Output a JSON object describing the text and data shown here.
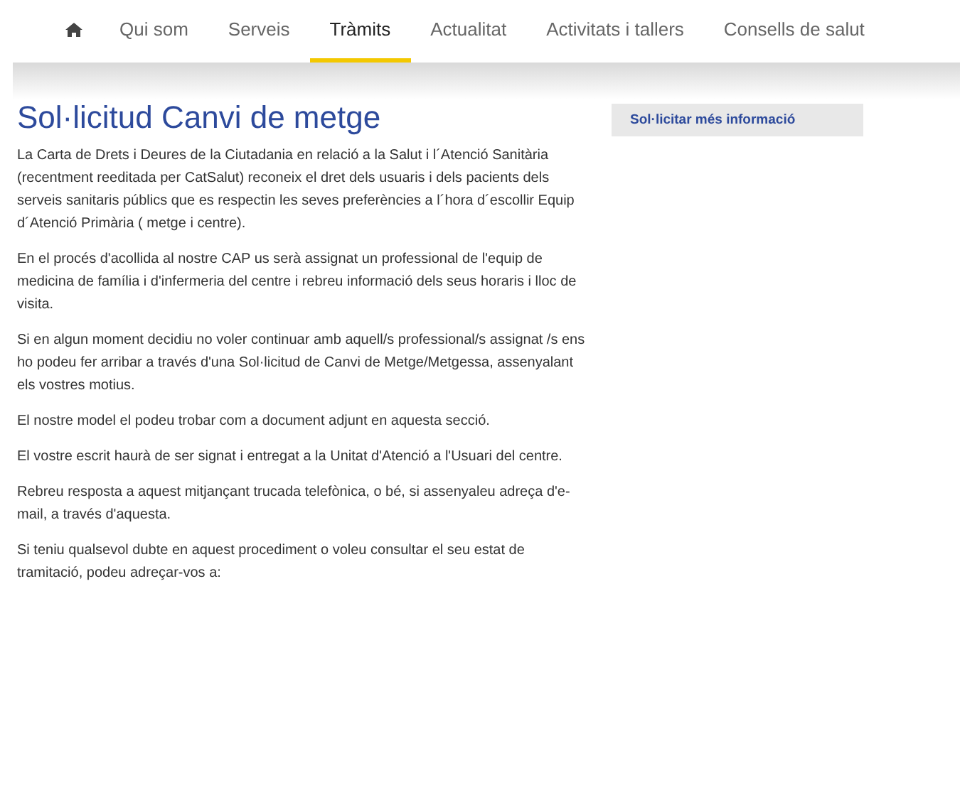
{
  "nav": {
    "items": [
      {
        "kind": "home",
        "selected": false
      },
      {
        "kind": "text",
        "label": "Qui som",
        "selected": false
      },
      {
        "kind": "text",
        "label": "Serveis",
        "selected": false
      },
      {
        "kind": "text",
        "label": "Tràmits",
        "selected": true
      },
      {
        "kind": "text",
        "label": "Actualitat",
        "selected": false
      },
      {
        "kind": "text",
        "label": "Activitats i tallers",
        "selected": false
      },
      {
        "kind": "text",
        "label": "Consells de salut",
        "selected": false
      }
    ]
  },
  "article": {
    "title": "Sol·licitud Canvi de metge",
    "paragraphs": [
      "La Carta de Drets i Deures de la Ciutadania en relació a la Salut i l´Atenció Sanitària (recentment reeditada per CatSalut) reconeix el dret dels usuaris i dels pacients dels serveis sanitaris públics que es respectin les seves preferències a l´hora d´escollir Equip d´Atenció Primària ( metge i centre).",
      "En el procés d'acollida al nostre CAP us serà assignat un professional de l'equip de medicina de família i d'infermeria del centre i rebreu informació dels seus horaris i lloc de visita.",
      "Si en algun moment decidiu no voler continuar amb aquell/s professional/s assignat /s ens ho podeu fer arribar a través d'una Sol·licitud de Canvi de Metge/Metgessa, assenyalant els vostres motius.",
      "El nostre model el podeu trobar com a document adjunt en aquesta secció.",
      "El vostre escrit haurà de ser signat i entregat a la Unitat d'Atenció a l'Usuari del centre.",
      "Rebreu resposta a aquest mitjançant trucada telefònica, o bé, si assenyaleu adreça d'e-mail, a través d'aquesta.",
      "Si teniu qualsevol dubte en aquest procediment o voleu consultar el seu estat de tramitació, podeu adreçar-vos a:"
    ]
  },
  "sidebar": {
    "link": "Sol·licitar més informació"
  }
}
